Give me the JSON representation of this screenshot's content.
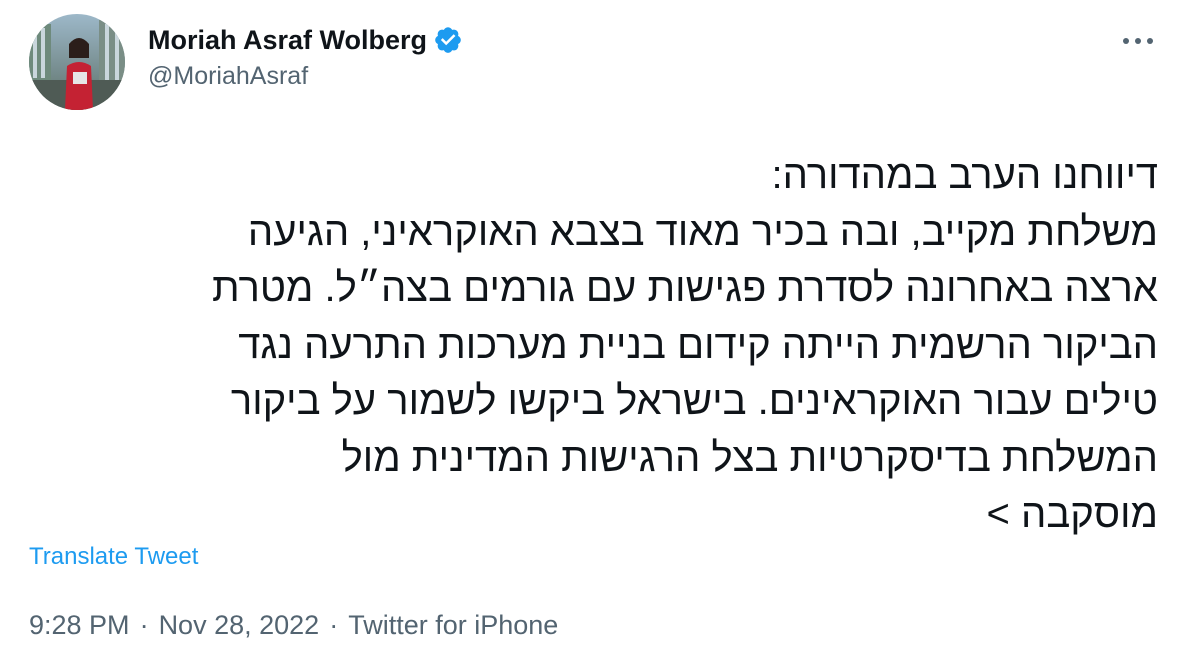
{
  "author": {
    "display_name": "Moriah Asraf Wolberg",
    "handle": "@MoriahAsraf",
    "verified": true,
    "avatar_icon": "profile-photo"
  },
  "tweet": {
    "lines": [
      "דיווחנו הערב במהדורה:",
      "משלחת מקייב, ובה בכיר מאוד בצבא האוקראיני, הגיעה",
      "ארצה באחרונה לסדרת פגישות עם גורמים בצה״ל. מטרת",
      "הביקור הרשמית הייתה קידום בניית מערכות התרעה נגד",
      "טילים עבור האוקראינים. בישראל ביקשו לשמור על ביקור",
      "המשלחת בדיסקרטיות בצל הרגישות המדינית מול",
      "מוסקבה >"
    ],
    "translate_label": "Translate Tweet"
  },
  "meta": {
    "time": "9:28 PM",
    "date": "Nov 28, 2022",
    "source": "Twitter for iPhone",
    "separator": "·"
  },
  "colors": {
    "link": "#1d9bf0",
    "secondary": "#536471",
    "primary_text": "#0f1419",
    "verified_badge": "#1d9bf0"
  }
}
